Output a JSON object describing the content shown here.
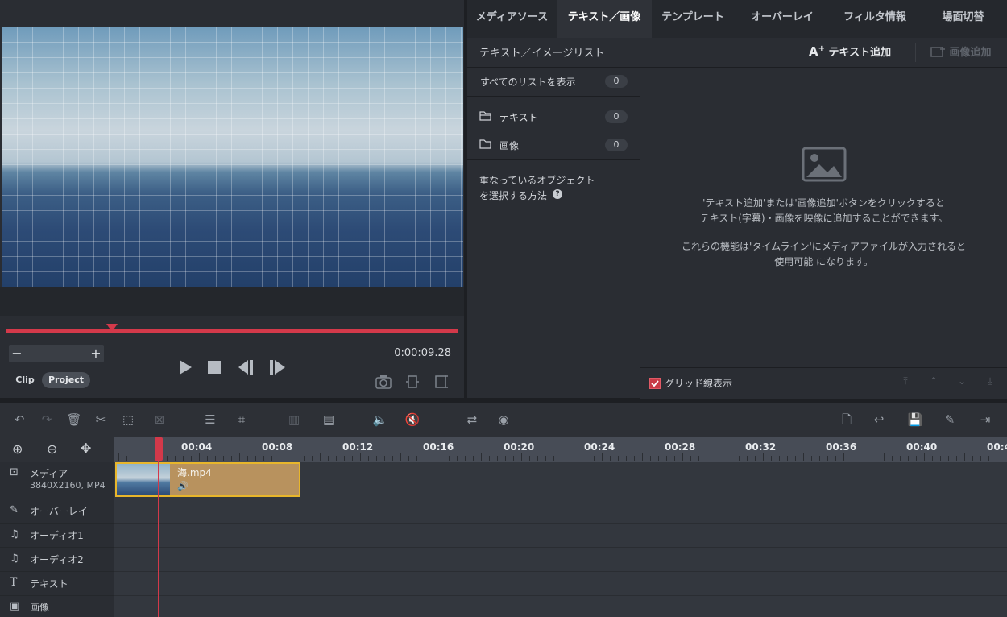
{
  "preview": {
    "timecode": "0:00:09.28",
    "clip_label": "Clip",
    "project_label": "Project",
    "zoom_minus": "−",
    "zoom_plus": "+",
    "icons": [
      "play-icon",
      "stop-icon",
      "prev-frame-icon",
      "next-frame-icon",
      "snapshot-icon",
      "aspect-icon",
      "split-icon"
    ]
  },
  "tabs": [
    {
      "label": "メディアソース"
    },
    {
      "label": "テキスト／画像"
    },
    {
      "label": "テンプレート"
    },
    {
      "label": "オーバーレイ"
    },
    {
      "label": "フィルタ情報"
    },
    {
      "label": "場面切替"
    }
  ],
  "active_tab": "テキスト／画像",
  "list": {
    "title": "テキスト／イメージリスト",
    "add_text": "テキスト追加",
    "add_image": "画像追加",
    "show_all": {
      "label": "すべてのリストを表示",
      "count": "0"
    },
    "text": {
      "label": "テキスト",
      "count": "0"
    },
    "image": {
      "label": "画像",
      "count": "0"
    },
    "help_line1": "重なっているオブジェクト",
    "help_line2": "を選択する方法"
  },
  "empty_state": {
    "line1": "'テキスト追加'または'画像追加'ボタンをクリックすると",
    "line2": "テキスト(字幕)・画像を映像に追加することができます。",
    "line3": "これらの機能は'タイムライン'にメディアファイルが入力されると",
    "line4": "使用可能 になります。"
  },
  "grid": {
    "label": "グリッド線表示",
    "checked": true
  },
  "ruler": {
    "labels": [
      "00:04",
      "00:08",
      "00:12",
      "00:16",
      "00:20",
      "00:24",
      "00:28",
      "00:32",
      "00:36",
      "00:40",
      "00:4"
    ]
  },
  "tracks": [
    {
      "name": "メディア",
      "detail": "3840X2160, MP4",
      "icon": "film-icon"
    },
    {
      "name": "オーバーレイ",
      "icon": "overlay-icon"
    },
    {
      "name": "オーディオ1",
      "icon": "music-note-icon"
    },
    {
      "name": "オーディオ2",
      "icon": "music-note-icon"
    },
    {
      "name": "テキスト",
      "icon": "text-t-icon"
    },
    {
      "name": "画像",
      "icon": "image-icon"
    }
  ],
  "clip": {
    "filename": "海.mp4",
    "audio_symbol": "🔊"
  },
  "colors": {
    "accent_red": "#d3394a",
    "clip_border": "#e8b62b",
    "clip_fill": "#b8925e"
  }
}
